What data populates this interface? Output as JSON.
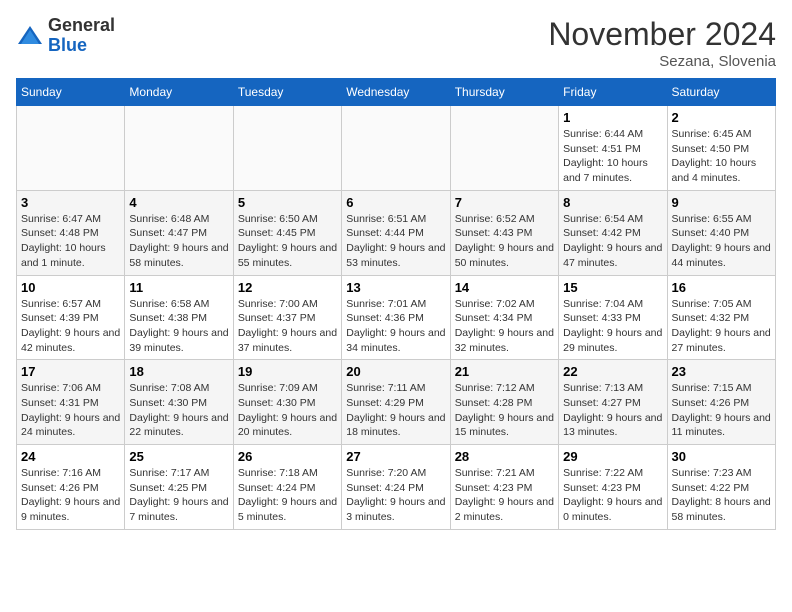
{
  "logo": {
    "general": "General",
    "blue": "Blue"
  },
  "header": {
    "month": "November 2024",
    "location": "Sezana, Slovenia"
  },
  "weekdays": [
    "Sunday",
    "Monday",
    "Tuesday",
    "Wednesday",
    "Thursday",
    "Friday",
    "Saturday"
  ],
  "weeks": [
    [
      {
        "day": null
      },
      {
        "day": null
      },
      {
        "day": null
      },
      {
        "day": null
      },
      {
        "day": null
      },
      {
        "day": "1",
        "sunrise": "Sunrise: 6:44 AM",
        "sunset": "Sunset: 4:51 PM",
        "daylight": "Daylight: 10 hours and 7 minutes."
      },
      {
        "day": "2",
        "sunrise": "Sunrise: 6:45 AM",
        "sunset": "Sunset: 4:50 PM",
        "daylight": "Daylight: 10 hours and 4 minutes."
      }
    ],
    [
      {
        "day": "3",
        "sunrise": "Sunrise: 6:47 AM",
        "sunset": "Sunset: 4:48 PM",
        "daylight": "Daylight: 10 hours and 1 minute."
      },
      {
        "day": "4",
        "sunrise": "Sunrise: 6:48 AM",
        "sunset": "Sunset: 4:47 PM",
        "daylight": "Daylight: 9 hours and 58 minutes."
      },
      {
        "day": "5",
        "sunrise": "Sunrise: 6:50 AM",
        "sunset": "Sunset: 4:45 PM",
        "daylight": "Daylight: 9 hours and 55 minutes."
      },
      {
        "day": "6",
        "sunrise": "Sunrise: 6:51 AM",
        "sunset": "Sunset: 4:44 PM",
        "daylight": "Daylight: 9 hours and 53 minutes."
      },
      {
        "day": "7",
        "sunrise": "Sunrise: 6:52 AM",
        "sunset": "Sunset: 4:43 PM",
        "daylight": "Daylight: 9 hours and 50 minutes."
      },
      {
        "day": "8",
        "sunrise": "Sunrise: 6:54 AM",
        "sunset": "Sunset: 4:42 PM",
        "daylight": "Daylight: 9 hours and 47 minutes."
      },
      {
        "day": "9",
        "sunrise": "Sunrise: 6:55 AM",
        "sunset": "Sunset: 4:40 PM",
        "daylight": "Daylight: 9 hours and 44 minutes."
      }
    ],
    [
      {
        "day": "10",
        "sunrise": "Sunrise: 6:57 AM",
        "sunset": "Sunset: 4:39 PM",
        "daylight": "Daylight: 9 hours and 42 minutes."
      },
      {
        "day": "11",
        "sunrise": "Sunrise: 6:58 AM",
        "sunset": "Sunset: 4:38 PM",
        "daylight": "Daylight: 9 hours and 39 minutes."
      },
      {
        "day": "12",
        "sunrise": "Sunrise: 7:00 AM",
        "sunset": "Sunset: 4:37 PM",
        "daylight": "Daylight: 9 hours and 37 minutes."
      },
      {
        "day": "13",
        "sunrise": "Sunrise: 7:01 AM",
        "sunset": "Sunset: 4:36 PM",
        "daylight": "Daylight: 9 hours and 34 minutes."
      },
      {
        "day": "14",
        "sunrise": "Sunrise: 7:02 AM",
        "sunset": "Sunset: 4:34 PM",
        "daylight": "Daylight: 9 hours and 32 minutes."
      },
      {
        "day": "15",
        "sunrise": "Sunrise: 7:04 AM",
        "sunset": "Sunset: 4:33 PM",
        "daylight": "Daylight: 9 hours and 29 minutes."
      },
      {
        "day": "16",
        "sunrise": "Sunrise: 7:05 AM",
        "sunset": "Sunset: 4:32 PM",
        "daylight": "Daylight: 9 hours and 27 minutes."
      }
    ],
    [
      {
        "day": "17",
        "sunrise": "Sunrise: 7:06 AM",
        "sunset": "Sunset: 4:31 PM",
        "daylight": "Daylight: 9 hours and 24 minutes."
      },
      {
        "day": "18",
        "sunrise": "Sunrise: 7:08 AM",
        "sunset": "Sunset: 4:30 PM",
        "daylight": "Daylight: 9 hours and 22 minutes."
      },
      {
        "day": "19",
        "sunrise": "Sunrise: 7:09 AM",
        "sunset": "Sunset: 4:30 PM",
        "daylight": "Daylight: 9 hours and 20 minutes."
      },
      {
        "day": "20",
        "sunrise": "Sunrise: 7:11 AM",
        "sunset": "Sunset: 4:29 PM",
        "daylight": "Daylight: 9 hours and 18 minutes."
      },
      {
        "day": "21",
        "sunrise": "Sunrise: 7:12 AM",
        "sunset": "Sunset: 4:28 PM",
        "daylight": "Daylight: 9 hours and 15 minutes."
      },
      {
        "day": "22",
        "sunrise": "Sunrise: 7:13 AM",
        "sunset": "Sunset: 4:27 PM",
        "daylight": "Daylight: 9 hours and 13 minutes."
      },
      {
        "day": "23",
        "sunrise": "Sunrise: 7:15 AM",
        "sunset": "Sunset: 4:26 PM",
        "daylight": "Daylight: 9 hours and 11 minutes."
      }
    ],
    [
      {
        "day": "24",
        "sunrise": "Sunrise: 7:16 AM",
        "sunset": "Sunset: 4:26 PM",
        "daylight": "Daylight: 9 hours and 9 minutes."
      },
      {
        "day": "25",
        "sunrise": "Sunrise: 7:17 AM",
        "sunset": "Sunset: 4:25 PM",
        "daylight": "Daylight: 9 hours and 7 minutes."
      },
      {
        "day": "26",
        "sunrise": "Sunrise: 7:18 AM",
        "sunset": "Sunset: 4:24 PM",
        "daylight": "Daylight: 9 hours and 5 minutes."
      },
      {
        "day": "27",
        "sunrise": "Sunrise: 7:20 AM",
        "sunset": "Sunset: 4:24 PM",
        "daylight": "Daylight: 9 hours and 3 minutes."
      },
      {
        "day": "28",
        "sunrise": "Sunrise: 7:21 AM",
        "sunset": "Sunset: 4:23 PM",
        "daylight": "Daylight: 9 hours and 2 minutes."
      },
      {
        "day": "29",
        "sunrise": "Sunrise: 7:22 AM",
        "sunset": "Sunset: 4:23 PM",
        "daylight": "Daylight: 9 hours and 0 minutes."
      },
      {
        "day": "30",
        "sunrise": "Sunrise: 7:23 AM",
        "sunset": "Sunset: 4:22 PM",
        "daylight": "Daylight: 8 hours and 58 minutes."
      }
    ]
  ]
}
